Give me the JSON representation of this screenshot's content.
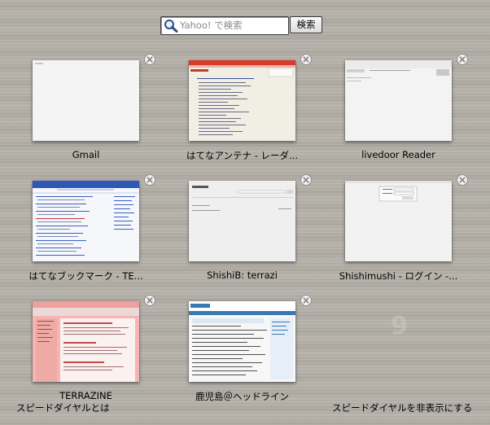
{
  "search": {
    "placeholder": "Yahoo! で検索",
    "button_label": "検索"
  },
  "dials": [
    {
      "title": "Gmail"
    },
    {
      "title": "はてなアンテナ - レーダ..."
    },
    {
      "title": "livedoor Reader"
    },
    {
      "title": "はてなブックマーク - TE..."
    },
    {
      "title": "ShishiB: terrazi"
    },
    {
      "title": "Shishimushi - ログイン -..."
    },
    {
      "title": "TERRAZINE"
    },
    {
      "title": "鹿児島＠ヘッドライン"
    }
  ],
  "empty_slot_number": "9",
  "footer": {
    "about_link": "スピードダイヤルとは",
    "hide_link": "スピードダイヤルを非表示にする"
  },
  "icons": {
    "search": "search-icon",
    "close": "close-icon"
  },
  "colors": {
    "background": "#b2aea6",
    "hatena_antenna_header": "#d83a2c",
    "hatena_bookmark_header": "#2f57b8",
    "terrazine_bg": "#f2a3a3",
    "kagoshima_header": "#3a78b4"
  }
}
